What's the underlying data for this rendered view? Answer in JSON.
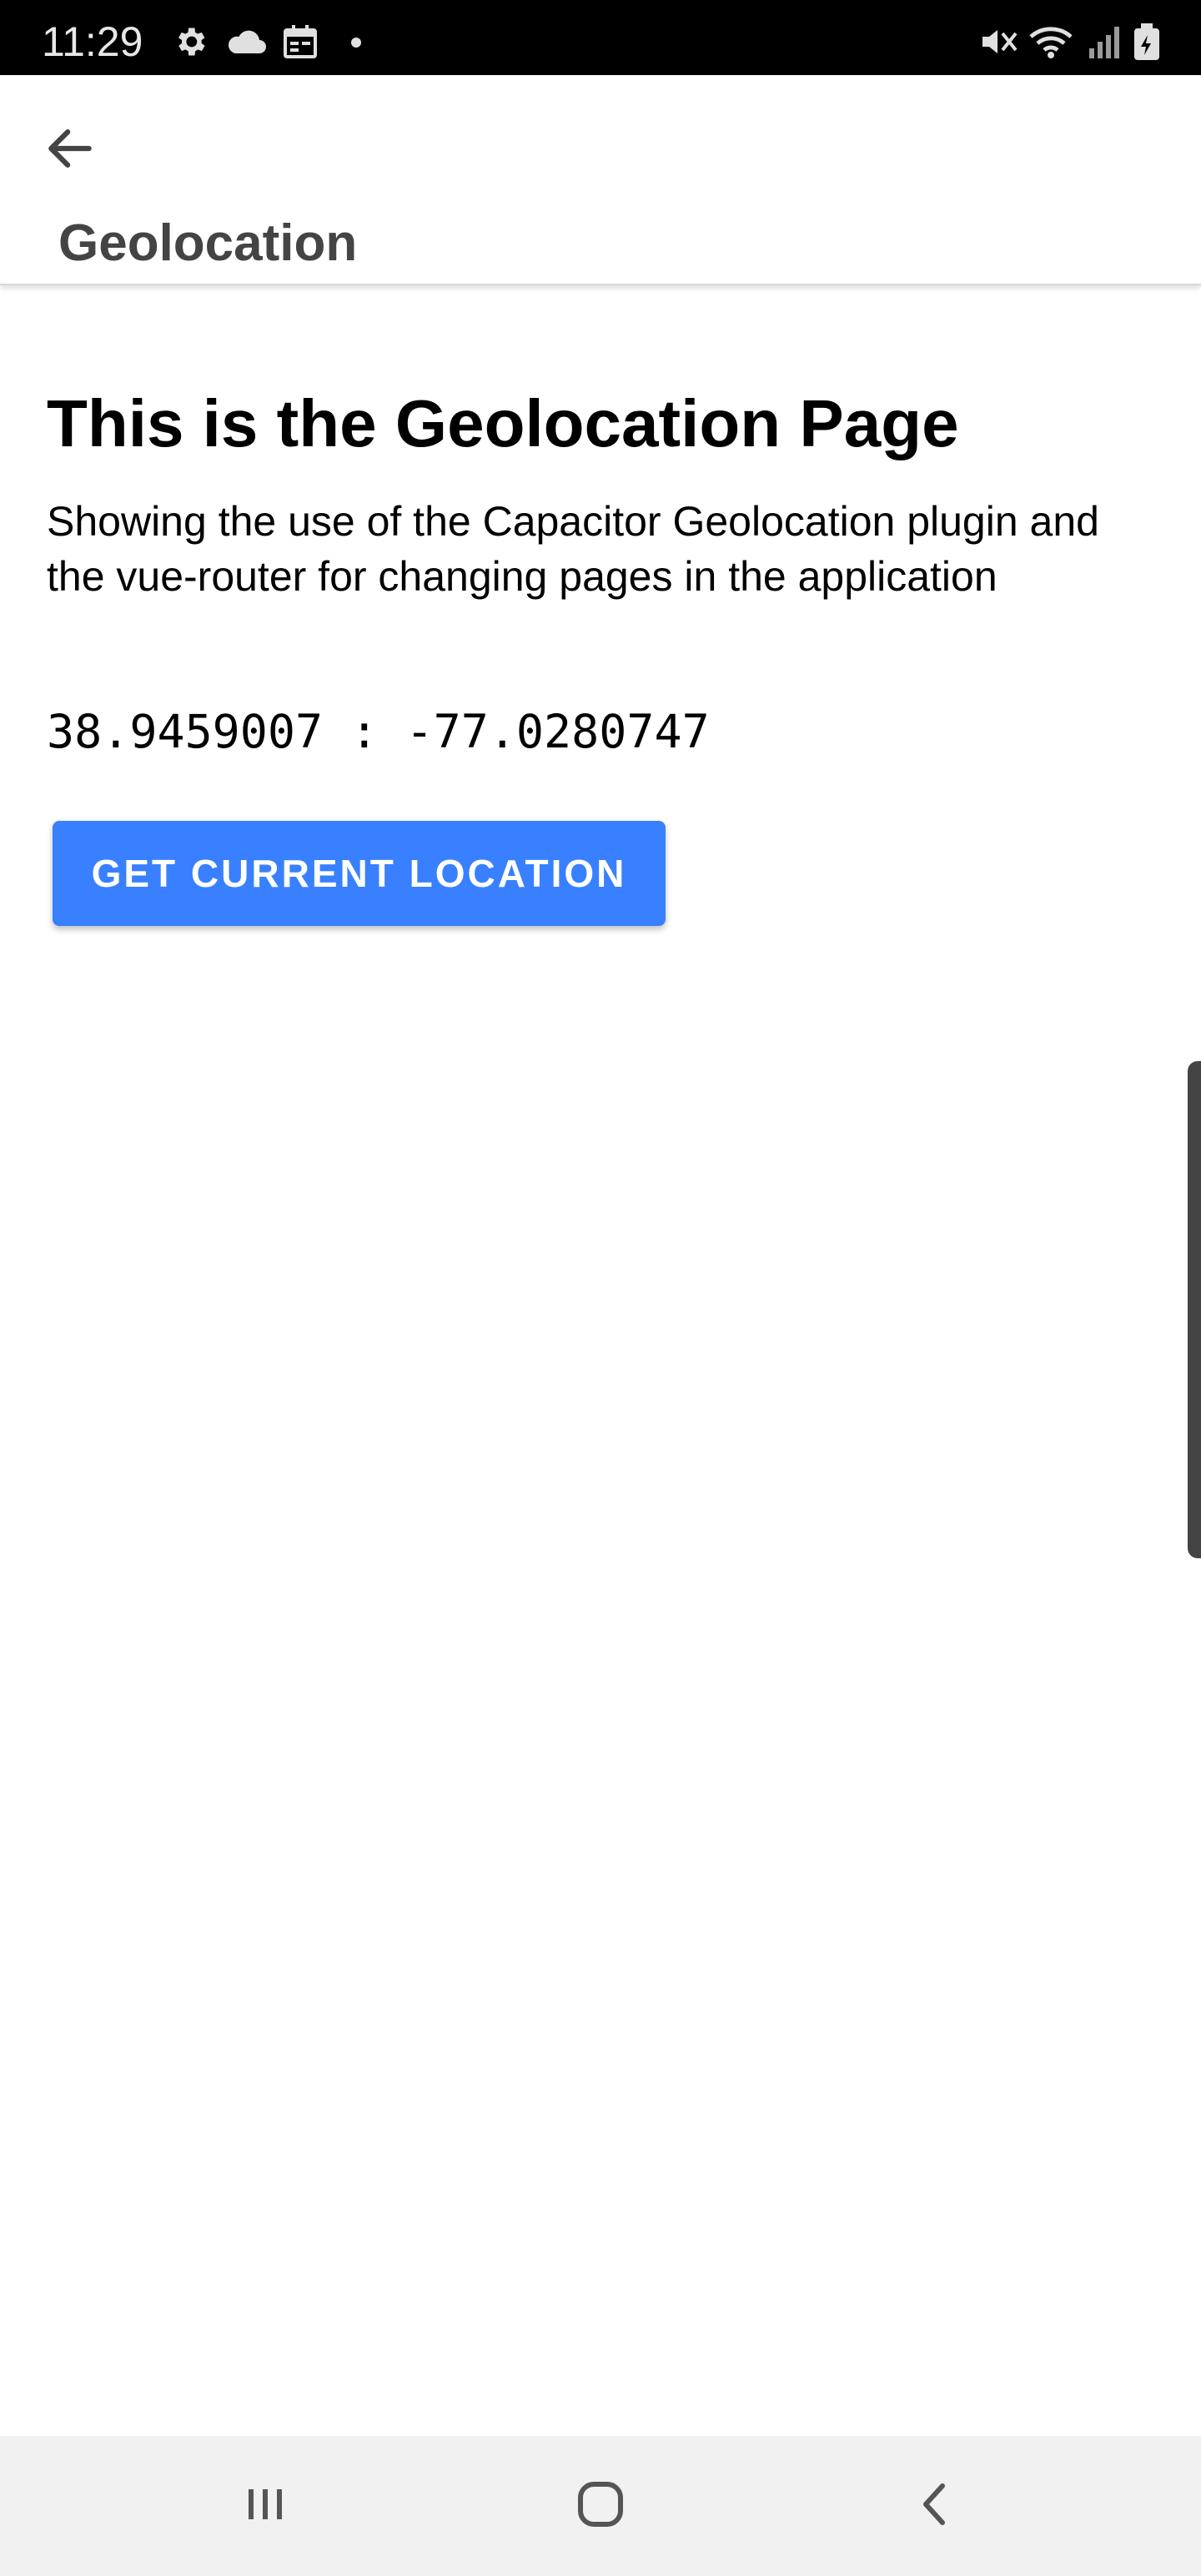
{
  "status_bar": {
    "time": "11:29",
    "left_icons": [
      "gear-icon",
      "cloud-icon",
      "calendar-icon",
      "dot-icon"
    ],
    "right_icons": [
      "mute-icon",
      "wifi-icon",
      "signal-icon",
      "battery-icon"
    ]
  },
  "toolbar": {
    "back_icon": "arrow-back-icon",
    "title": "Geolocation"
  },
  "main": {
    "heading": "This is the Geolocation Page",
    "description": "Showing the use of the Capacitor Geolocation plugin and the vue-router for changing pages in the application",
    "coordinates": "38.9459007 : -77.0280747",
    "button_label": "GET CURRENT LOCATION",
    "button_color": "#3880ff"
  },
  "nav_bar": {
    "items": [
      "recents-icon",
      "home-icon",
      "back-icon"
    ]
  }
}
